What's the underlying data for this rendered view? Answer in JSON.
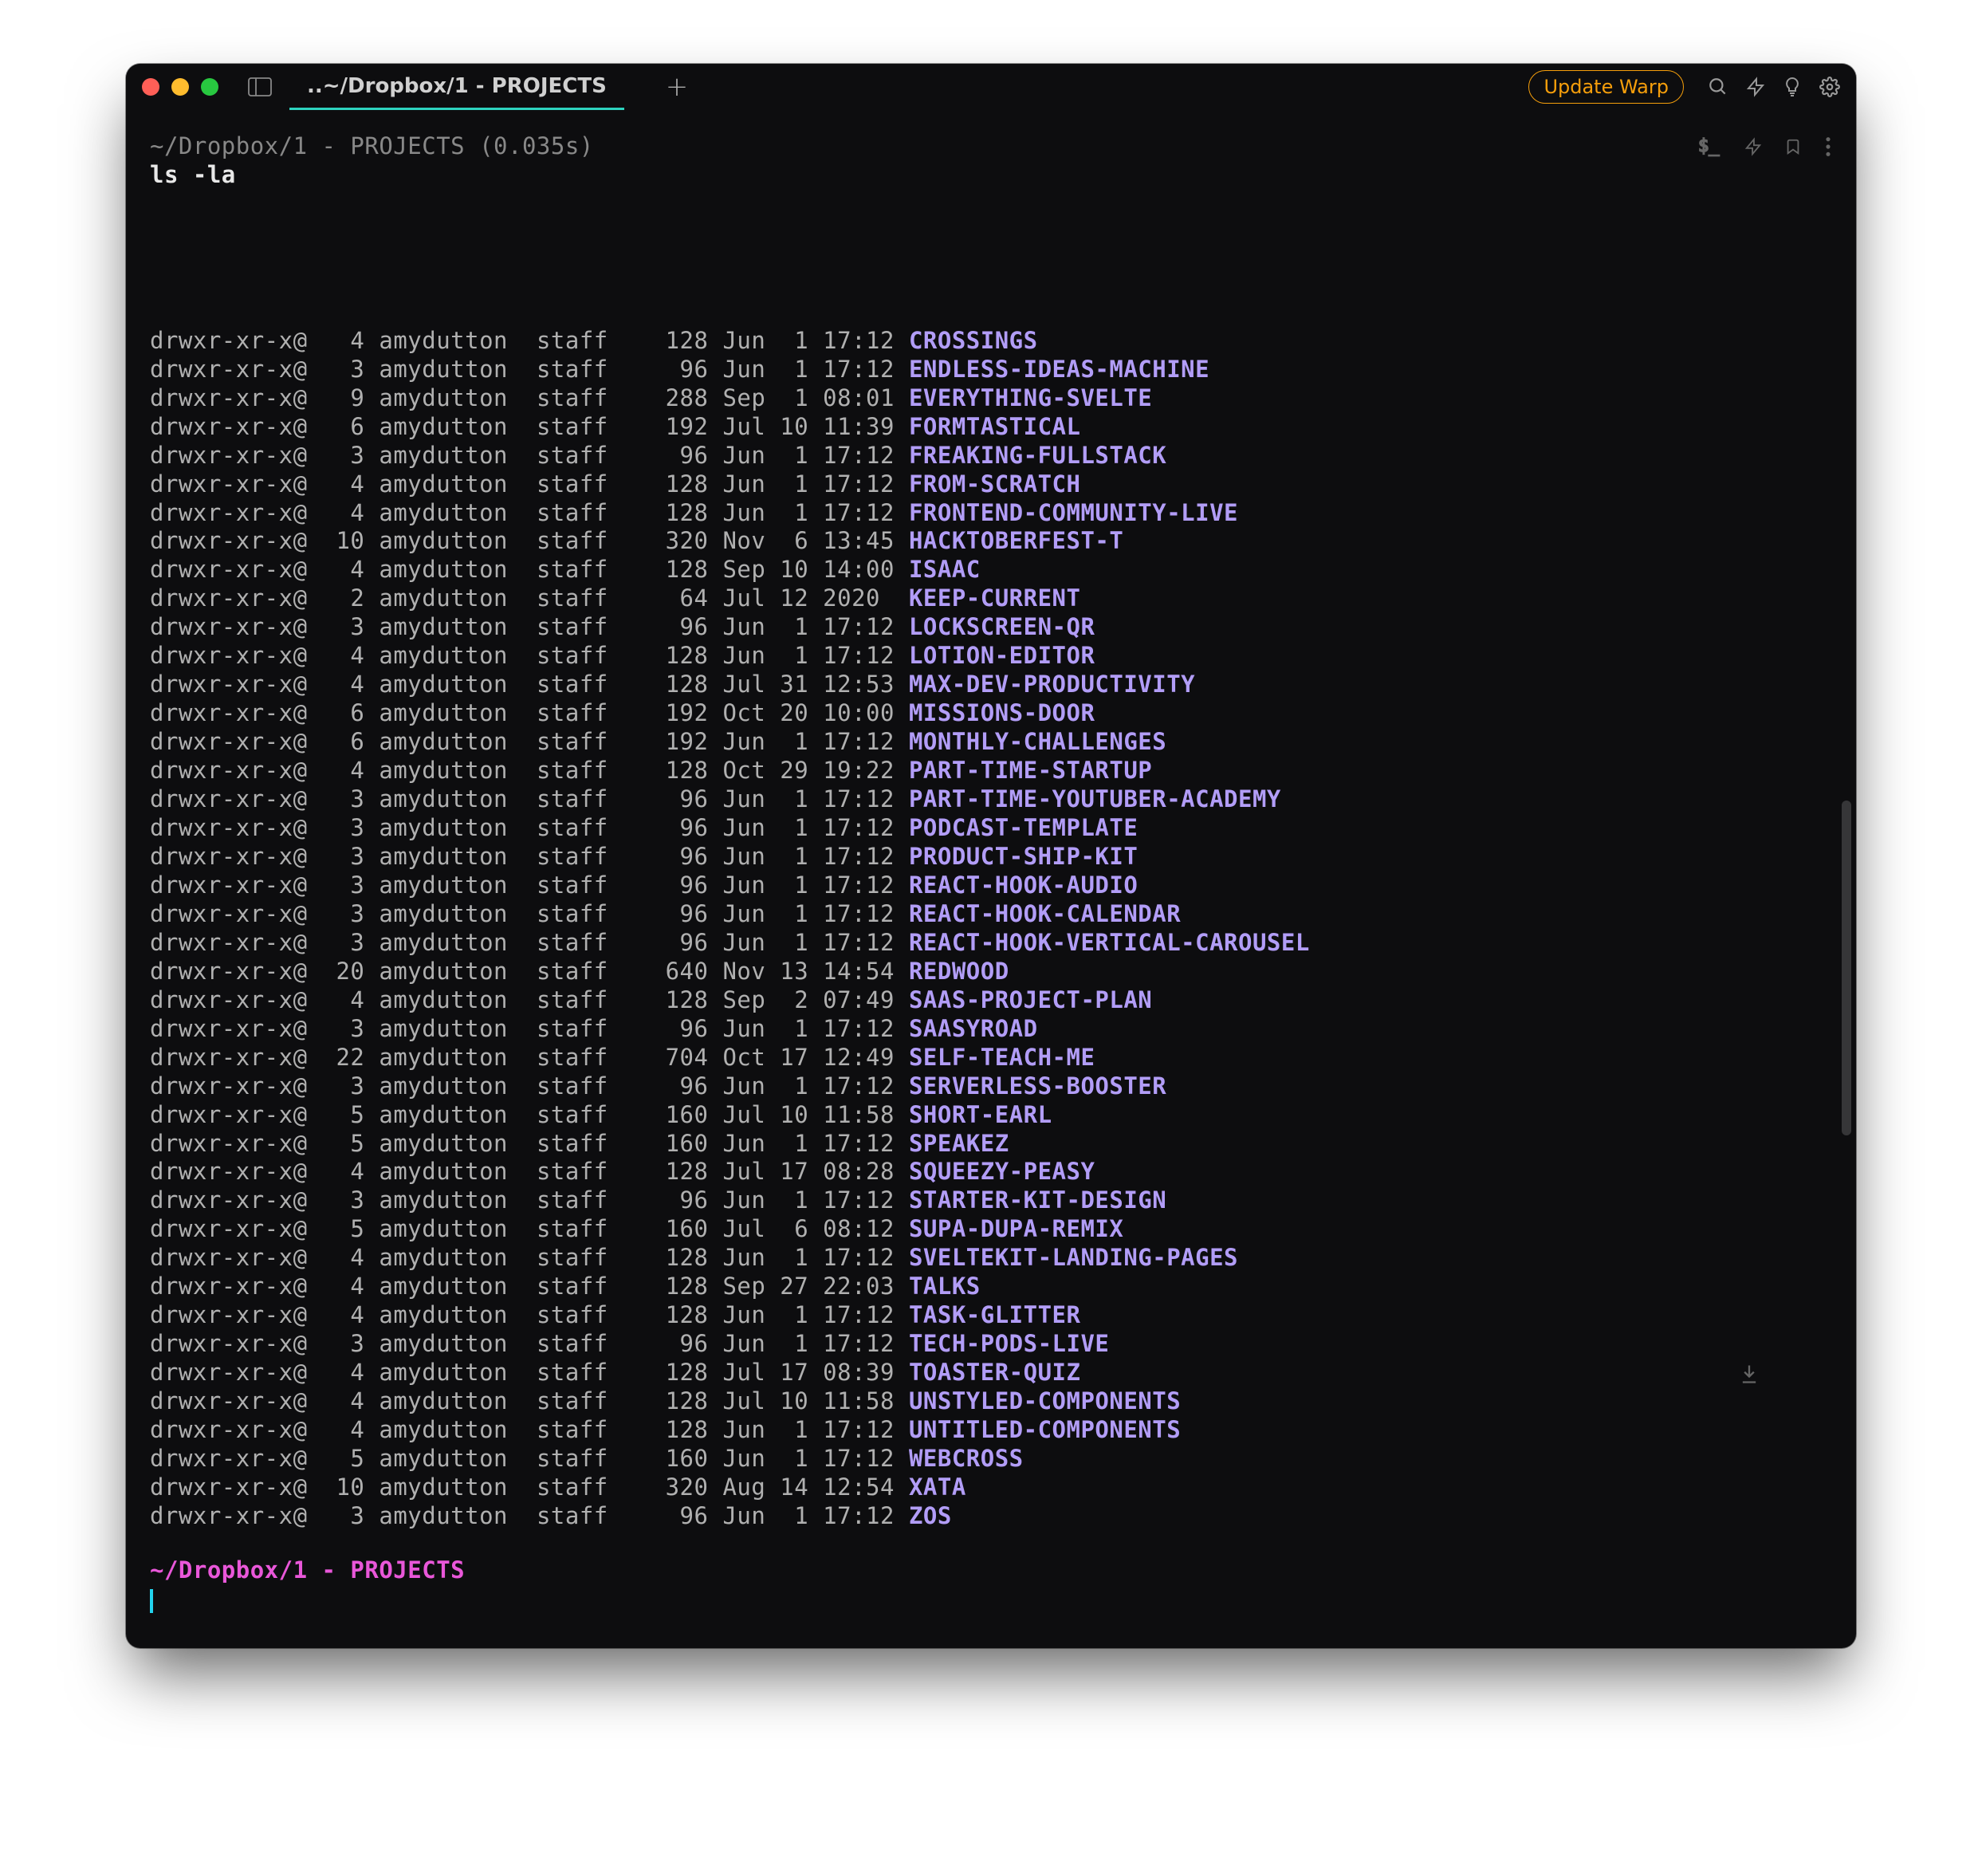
{
  "titlebar": {
    "tab_title": "..~/Dropbox/1 - PROJECTS",
    "update_label": "Update Warp"
  },
  "block": {
    "header_path": "~/Dropbox/1 - PROJECTS (0.035s)",
    "command": "ls -la"
  },
  "active": {
    "path": "~/Dropbox/1 - PROJECTS"
  },
  "listing": [
    {
      "perms": "drwxr-xr-x@",
      "links": "4",
      "owner": "amydutton",
      "group": "staff",
      "size": "128",
      "month": "Jun",
      "day": "1",
      "time": "17:12",
      "name": "CROSSINGS"
    },
    {
      "perms": "drwxr-xr-x@",
      "links": "3",
      "owner": "amydutton",
      "group": "staff",
      "size": "96",
      "month": "Jun",
      "day": "1",
      "time": "17:12",
      "name": "ENDLESS-IDEAS-MACHINE"
    },
    {
      "perms": "drwxr-xr-x@",
      "links": "9",
      "owner": "amydutton",
      "group": "staff",
      "size": "288",
      "month": "Sep",
      "day": "1",
      "time": "08:01",
      "name": "EVERYTHING-SVELTE"
    },
    {
      "perms": "drwxr-xr-x@",
      "links": "6",
      "owner": "amydutton",
      "group": "staff",
      "size": "192",
      "month": "Jul",
      "day": "10",
      "time": "11:39",
      "name": "FORMTASTICAL"
    },
    {
      "perms": "drwxr-xr-x@",
      "links": "3",
      "owner": "amydutton",
      "group": "staff",
      "size": "96",
      "month": "Jun",
      "day": "1",
      "time": "17:12",
      "name": "FREAKING-FULLSTACK"
    },
    {
      "perms": "drwxr-xr-x@",
      "links": "4",
      "owner": "amydutton",
      "group": "staff",
      "size": "128",
      "month": "Jun",
      "day": "1",
      "time": "17:12",
      "name": "FROM-SCRATCH"
    },
    {
      "perms": "drwxr-xr-x@",
      "links": "4",
      "owner": "amydutton",
      "group": "staff",
      "size": "128",
      "month": "Jun",
      "day": "1",
      "time": "17:12",
      "name": "FRONTEND-COMMUNITY-LIVE"
    },
    {
      "perms": "drwxr-xr-x@",
      "links": "10",
      "owner": "amydutton",
      "group": "staff",
      "size": "320",
      "month": "Nov",
      "day": "6",
      "time": "13:45",
      "name": "HACKTOBERFEST-T"
    },
    {
      "perms": "drwxr-xr-x@",
      "links": "4",
      "owner": "amydutton",
      "group": "staff",
      "size": "128",
      "month": "Sep",
      "day": "10",
      "time": "14:00",
      "name": "ISAAC"
    },
    {
      "perms": "drwxr-xr-x@",
      "links": "2",
      "owner": "amydutton",
      "group": "staff",
      "size": "64",
      "month": "Jul",
      "day": "12",
      "time": "2020",
      "name": "KEEP-CURRENT"
    },
    {
      "perms": "drwxr-xr-x@",
      "links": "3",
      "owner": "amydutton",
      "group": "staff",
      "size": "96",
      "month": "Jun",
      "day": "1",
      "time": "17:12",
      "name": "LOCKSCREEN-QR"
    },
    {
      "perms": "drwxr-xr-x@",
      "links": "4",
      "owner": "amydutton",
      "group": "staff",
      "size": "128",
      "month": "Jun",
      "day": "1",
      "time": "17:12",
      "name": "LOTION-EDITOR"
    },
    {
      "perms": "drwxr-xr-x@",
      "links": "4",
      "owner": "amydutton",
      "group": "staff",
      "size": "128",
      "month": "Jul",
      "day": "31",
      "time": "12:53",
      "name": "MAX-DEV-PRODUCTIVITY"
    },
    {
      "perms": "drwxr-xr-x@",
      "links": "6",
      "owner": "amydutton",
      "group": "staff",
      "size": "192",
      "month": "Oct",
      "day": "20",
      "time": "10:00",
      "name": "MISSIONS-DOOR"
    },
    {
      "perms": "drwxr-xr-x@",
      "links": "6",
      "owner": "amydutton",
      "group": "staff",
      "size": "192",
      "month": "Jun",
      "day": "1",
      "time": "17:12",
      "name": "MONTHLY-CHALLENGES"
    },
    {
      "perms": "drwxr-xr-x@",
      "links": "4",
      "owner": "amydutton",
      "group": "staff",
      "size": "128",
      "month": "Oct",
      "day": "29",
      "time": "19:22",
      "name": "PART-TIME-STARTUP"
    },
    {
      "perms": "drwxr-xr-x@",
      "links": "3",
      "owner": "amydutton",
      "group": "staff",
      "size": "96",
      "month": "Jun",
      "day": "1",
      "time": "17:12",
      "name": "PART-TIME-YOUTUBER-ACADEMY"
    },
    {
      "perms": "drwxr-xr-x@",
      "links": "3",
      "owner": "amydutton",
      "group": "staff",
      "size": "96",
      "month": "Jun",
      "day": "1",
      "time": "17:12",
      "name": "PODCAST-TEMPLATE"
    },
    {
      "perms": "drwxr-xr-x@",
      "links": "3",
      "owner": "amydutton",
      "group": "staff",
      "size": "96",
      "month": "Jun",
      "day": "1",
      "time": "17:12",
      "name": "PRODUCT-SHIP-KIT"
    },
    {
      "perms": "drwxr-xr-x@",
      "links": "3",
      "owner": "amydutton",
      "group": "staff",
      "size": "96",
      "month": "Jun",
      "day": "1",
      "time": "17:12",
      "name": "REACT-HOOK-AUDIO"
    },
    {
      "perms": "drwxr-xr-x@",
      "links": "3",
      "owner": "amydutton",
      "group": "staff",
      "size": "96",
      "month": "Jun",
      "day": "1",
      "time": "17:12",
      "name": "REACT-HOOK-CALENDAR"
    },
    {
      "perms": "drwxr-xr-x@",
      "links": "3",
      "owner": "amydutton",
      "group": "staff",
      "size": "96",
      "month": "Jun",
      "day": "1",
      "time": "17:12",
      "name": "REACT-HOOK-VERTICAL-CAROUSEL"
    },
    {
      "perms": "drwxr-xr-x@",
      "links": "20",
      "owner": "amydutton",
      "group": "staff",
      "size": "640",
      "month": "Nov",
      "day": "13",
      "time": "14:54",
      "name": "REDWOOD"
    },
    {
      "perms": "drwxr-xr-x@",
      "links": "4",
      "owner": "amydutton",
      "group": "staff",
      "size": "128",
      "month": "Sep",
      "day": "2",
      "time": "07:49",
      "name": "SAAS-PROJECT-PLAN"
    },
    {
      "perms": "drwxr-xr-x@",
      "links": "3",
      "owner": "amydutton",
      "group": "staff",
      "size": "96",
      "month": "Jun",
      "day": "1",
      "time": "17:12",
      "name": "SAASYROAD"
    },
    {
      "perms": "drwxr-xr-x@",
      "links": "22",
      "owner": "amydutton",
      "group": "staff",
      "size": "704",
      "month": "Oct",
      "day": "17",
      "time": "12:49",
      "name": "SELF-TEACH-ME"
    },
    {
      "perms": "drwxr-xr-x@",
      "links": "3",
      "owner": "amydutton",
      "group": "staff",
      "size": "96",
      "month": "Jun",
      "day": "1",
      "time": "17:12",
      "name": "SERVERLESS-BOOSTER"
    },
    {
      "perms": "drwxr-xr-x@",
      "links": "5",
      "owner": "amydutton",
      "group": "staff",
      "size": "160",
      "month": "Jul",
      "day": "10",
      "time": "11:58",
      "name": "SHORT-EARL"
    },
    {
      "perms": "drwxr-xr-x@",
      "links": "5",
      "owner": "amydutton",
      "group": "staff",
      "size": "160",
      "month": "Jun",
      "day": "1",
      "time": "17:12",
      "name": "SPEAKEZ"
    },
    {
      "perms": "drwxr-xr-x@",
      "links": "4",
      "owner": "amydutton",
      "group": "staff",
      "size": "128",
      "month": "Jul",
      "day": "17",
      "time": "08:28",
      "name": "SQUEEZY-PEASY"
    },
    {
      "perms": "drwxr-xr-x@",
      "links": "3",
      "owner": "amydutton",
      "group": "staff",
      "size": "96",
      "month": "Jun",
      "day": "1",
      "time": "17:12",
      "name": "STARTER-KIT-DESIGN"
    },
    {
      "perms": "drwxr-xr-x@",
      "links": "5",
      "owner": "amydutton",
      "group": "staff",
      "size": "160",
      "month": "Jul",
      "day": "6",
      "time": "08:12",
      "name": "SUPA-DUPA-REMIX"
    },
    {
      "perms": "drwxr-xr-x@",
      "links": "4",
      "owner": "amydutton",
      "group": "staff",
      "size": "128",
      "month": "Jun",
      "day": "1",
      "time": "17:12",
      "name": "SVELTEKIT-LANDING-PAGES"
    },
    {
      "perms": "drwxr-xr-x@",
      "links": "4",
      "owner": "amydutton",
      "group": "staff",
      "size": "128",
      "month": "Sep",
      "day": "27",
      "time": "22:03",
      "name": "TALKS"
    },
    {
      "perms": "drwxr-xr-x@",
      "links": "4",
      "owner": "amydutton",
      "group": "staff",
      "size": "128",
      "month": "Jun",
      "day": "1",
      "time": "17:12",
      "name": "TASK-GLITTER"
    },
    {
      "perms": "drwxr-xr-x@",
      "links": "3",
      "owner": "amydutton",
      "group": "staff",
      "size": "96",
      "month": "Jun",
      "day": "1",
      "time": "17:12",
      "name": "TECH-PODS-LIVE"
    },
    {
      "perms": "drwxr-xr-x@",
      "links": "4",
      "owner": "amydutton",
      "group": "staff",
      "size": "128",
      "month": "Jul",
      "day": "17",
      "time": "08:39",
      "name": "TOASTER-QUIZ"
    },
    {
      "perms": "drwxr-xr-x@",
      "links": "4",
      "owner": "amydutton",
      "group": "staff",
      "size": "128",
      "month": "Jul",
      "day": "10",
      "time": "11:58",
      "name": "UNSTYLED-COMPONENTS"
    },
    {
      "perms": "drwxr-xr-x@",
      "links": "4",
      "owner": "amydutton",
      "group": "staff",
      "size": "128",
      "month": "Jun",
      "day": "1",
      "time": "17:12",
      "name": "UNTITLED-COMPONENTS"
    },
    {
      "perms": "drwxr-xr-x@",
      "links": "5",
      "owner": "amydutton",
      "group": "staff",
      "size": "160",
      "month": "Jun",
      "day": "1",
      "time": "17:12",
      "name": "WEBCROSS"
    },
    {
      "perms": "drwxr-xr-x@",
      "links": "10",
      "owner": "amydutton",
      "group": "staff",
      "size": "320",
      "month": "Aug",
      "day": "14",
      "time": "12:54",
      "name": "XATA"
    },
    {
      "perms": "drwxr-xr-x@",
      "links": "3",
      "owner": "amydutton",
      "group": "staff",
      "size": "96",
      "month": "Jun",
      "day": "1",
      "time": "17:12",
      "name": "ZOS"
    }
  ]
}
